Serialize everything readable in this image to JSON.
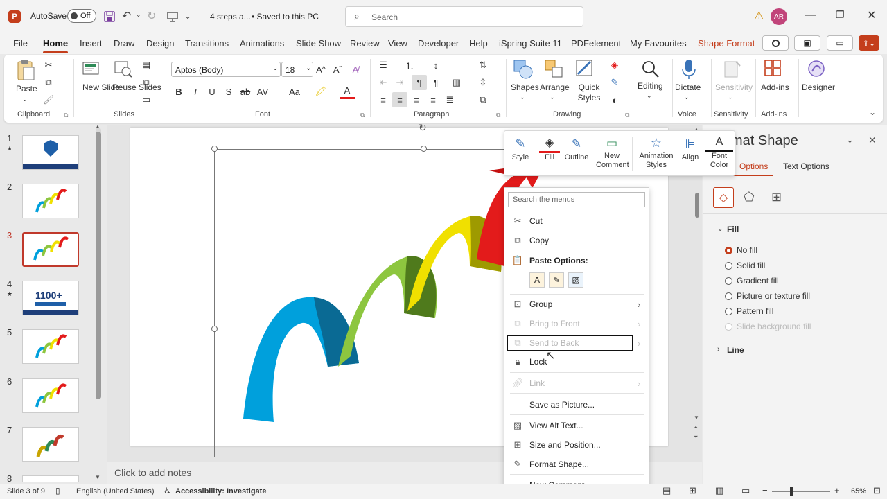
{
  "titlebar": {
    "autosave_label": "AutoSave",
    "autosave_state": "Off",
    "doc_title": "4 steps a...",
    "save_status": "• Saved to this PC",
    "search_placeholder": "Search",
    "user_initials": "AR"
  },
  "tabs": [
    "File",
    "Home",
    "Insert",
    "Draw",
    "Design",
    "Transitions",
    "Animations",
    "Slide Show",
    "Review",
    "View",
    "Developer",
    "Help",
    "iSpring Suite 11",
    "PDFelement",
    "My Favourites",
    "Shape Format"
  ],
  "active_tab": "Home",
  "ribbon": {
    "paste": "Paste",
    "new_slide": "New Slide",
    "reuse_slides": "Reuse Slides",
    "font_name": "Aptos (Body)",
    "font_size": "18",
    "shapes": "Shapes",
    "arrange": "Arrange",
    "quick_styles": "Quick Styles",
    "editing": "Editing",
    "dictate": "Dictate",
    "sensitivity": "Sensitivity",
    "addins": "Add-ins",
    "designer": "Designer",
    "groups": {
      "clipboard": "Clipboard",
      "slides": "Slides",
      "font": "Font",
      "paragraph": "Paragraph",
      "drawing": "Drawing",
      "voice": "Voice",
      "sensitivity": "Sensitivity",
      "addins": "Add-ins"
    }
  },
  "thumbnails": [
    {
      "num": "1",
      "star": "★"
    },
    {
      "num": "2",
      "star": ""
    },
    {
      "num": "3",
      "star": ""
    },
    {
      "num": "4",
      "star": "★",
      "text": "1100+"
    },
    {
      "num": "5",
      "star": ""
    },
    {
      "num": "6",
      "star": ""
    },
    {
      "num": "7",
      "star": ""
    },
    {
      "num": "8",
      "star": ""
    }
  ],
  "selected_slide": 3,
  "notes_placeholder": "Click to add notes",
  "format_pane": {
    "title": "Format Shape",
    "tab_shape": "Options",
    "tab_text": "Text Options",
    "fill_header": "Fill",
    "fill_options": [
      "No fill",
      "Solid fill",
      "Gradient fill",
      "Picture or texture fill",
      "Pattern fill",
      "Slide background fill"
    ],
    "selected_fill": "No fill",
    "line_header": "Line"
  },
  "mini_toolbar": {
    "style": "Style",
    "fill": "Fill",
    "outline": "Outline",
    "new_comment": "New Comment",
    "animation_styles": "Animation Styles",
    "align": "Align",
    "font_color": "Font Color"
  },
  "context_menu": {
    "search_placeholder": "Search the menus",
    "cut": "Cut",
    "copy": "Copy",
    "paste_options": "Paste Options:",
    "group": "Group",
    "bring_to_front": "Bring to Front",
    "send_to_back": "Send to Back",
    "lock": "Lock",
    "link": "Link",
    "save_as_picture": "Save as Picture...",
    "view_alt_text": "View Alt Text...",
    "size_and_position": "Size and Position...",
    "format_shape": "Format Shape...",
    "new_comment": "New Comment"
  },
  "statusbar": {
    "slide_info": "Slide 3 of 9",
    "language": "English (United States)",
    "accessibility": "Accessibility: Investigate",
    "zoom": "65%"
  },
  "colors": {
    "accent": "#c43e1c",
    "blue_arch": "#00a0dc",
    "green_arch": "#8dc63f",
    "yellow_arch": "#f0e000",
    "red_arch": "#e31b1b",
    "selection_outline": "#c0392b"
  }
}
